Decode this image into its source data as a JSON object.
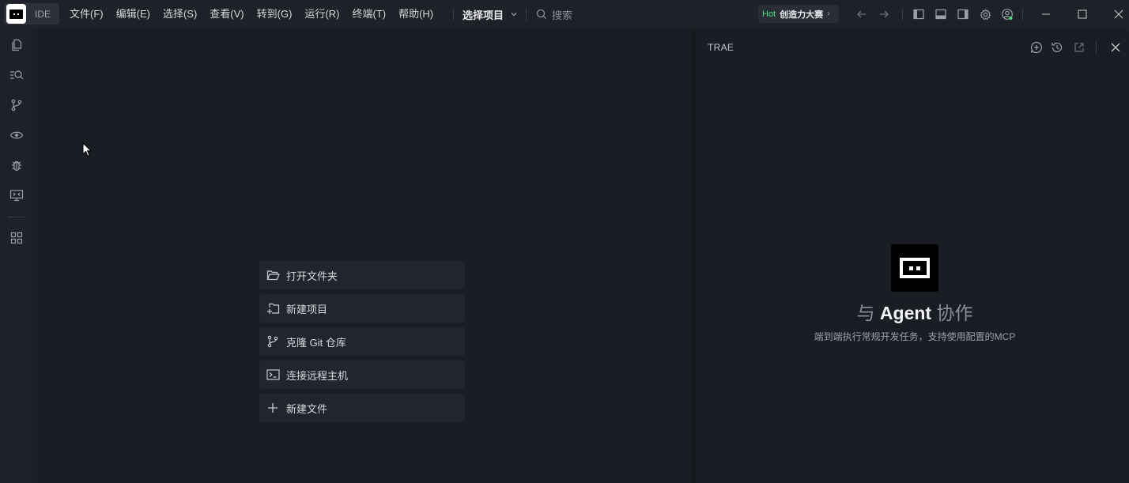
{
  "titlebar": {
    "ide_label": "IDE",
    "menu": [
      "文件(F)",
      "编辑(E)",
      "选择(S)",
      "查看(V)",
      "转到(G)",
      "运行(R)",
      "终端(T)",
      "帮助(H)"
    ],
    "project_select": "选择项目",
    "search_placeholder": "搜索",
    "hot_tag": "Hot",
    "hot_text": "创造力大赛",
    "hot_arrow": "›"
  },
  "activitybar": {
    "icons": [
      "files-icon",
      "search-icon",
      "source-control-icon",
      "preview-icon",
      "debug-icon",
      "remote-explorer-icon",
      "extensions-icon"
    ]
  },
  "editor": {
    "actions": [
      {
        "label": "打开文件夹",
        "icon": "folder-open-icon"
      },
      {
        "label": "新建项目",
        "icon": "new-project-icon"
      },
      {
        "label": "克隆 Git 仓库",
        "icon": "git-branch-icon"
      },
      {
        "label": "连接远程主机",
        "icon": "terminal-icon"
      },
      {
        "label": "新建文件",
        "icon": "plus-icon"
      }
    ]
  },
  "agent_panel": {
    "title": "TRAE",
    "heading_pre": "与",
    "heading_name": "Agent",
    "heading_post": "协作",
    "subtitle": "端到端执行常规开发任务，支持使用配置的MCP"
  },
  "colors": {
    "background": "#1f2129",
    "editor_bg": "#1b1d24",
    "accent_green": "#4ade80"
  }
}
